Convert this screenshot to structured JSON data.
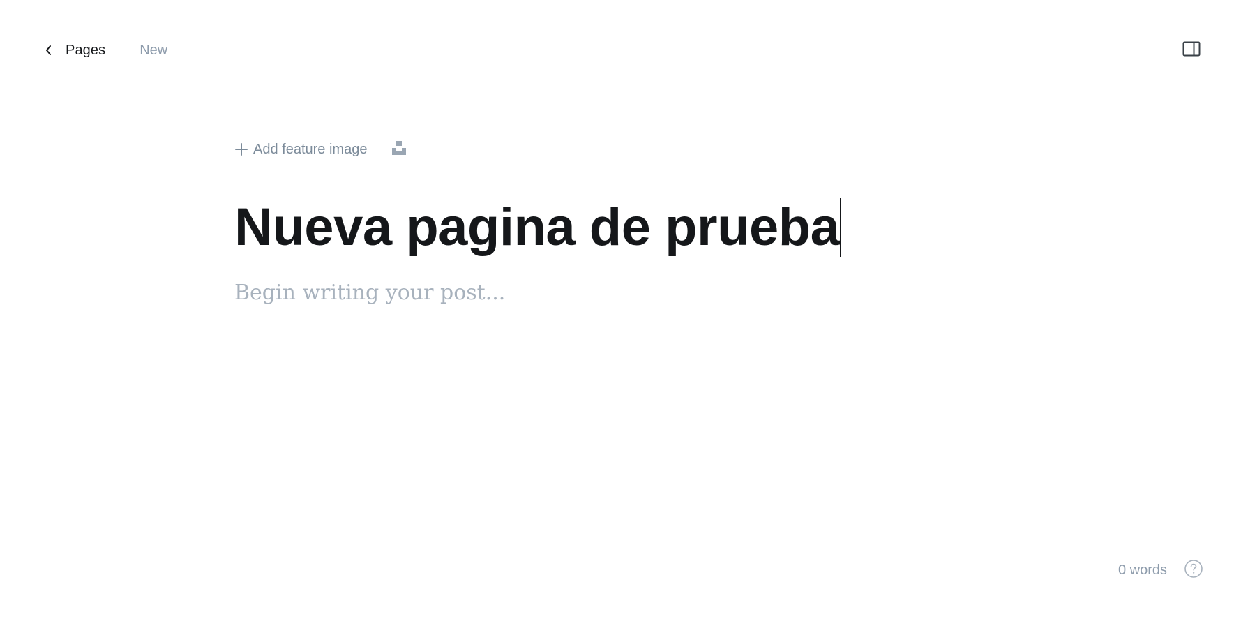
{
  "header": {
    "back_label": "Pages",
    "status": "New",
    "back_icon": "chevron-left-icon",
    "settings_icon": "sidebar-panel-icon"
  },
  "editor": {
    "add_feature_image_label": "Add feature image",
    "plus_icon": "plus-icon",
    "unsplash_icon": "unsplash-icon",
    "title": "Nueva pagina de prueba",
    "body_placeholder": "Begin writing your post..."
  },
  "footer": {
    "word_count": "0 words",
    "help_icon": "question-circle-icon"
  },
  "colors": {
    "text_primary": "#15171a",
    "text_muted": "#8e9cac",
    "placeholder": "#a8b2bd",
    "background": "#ffffff"
  }
}
